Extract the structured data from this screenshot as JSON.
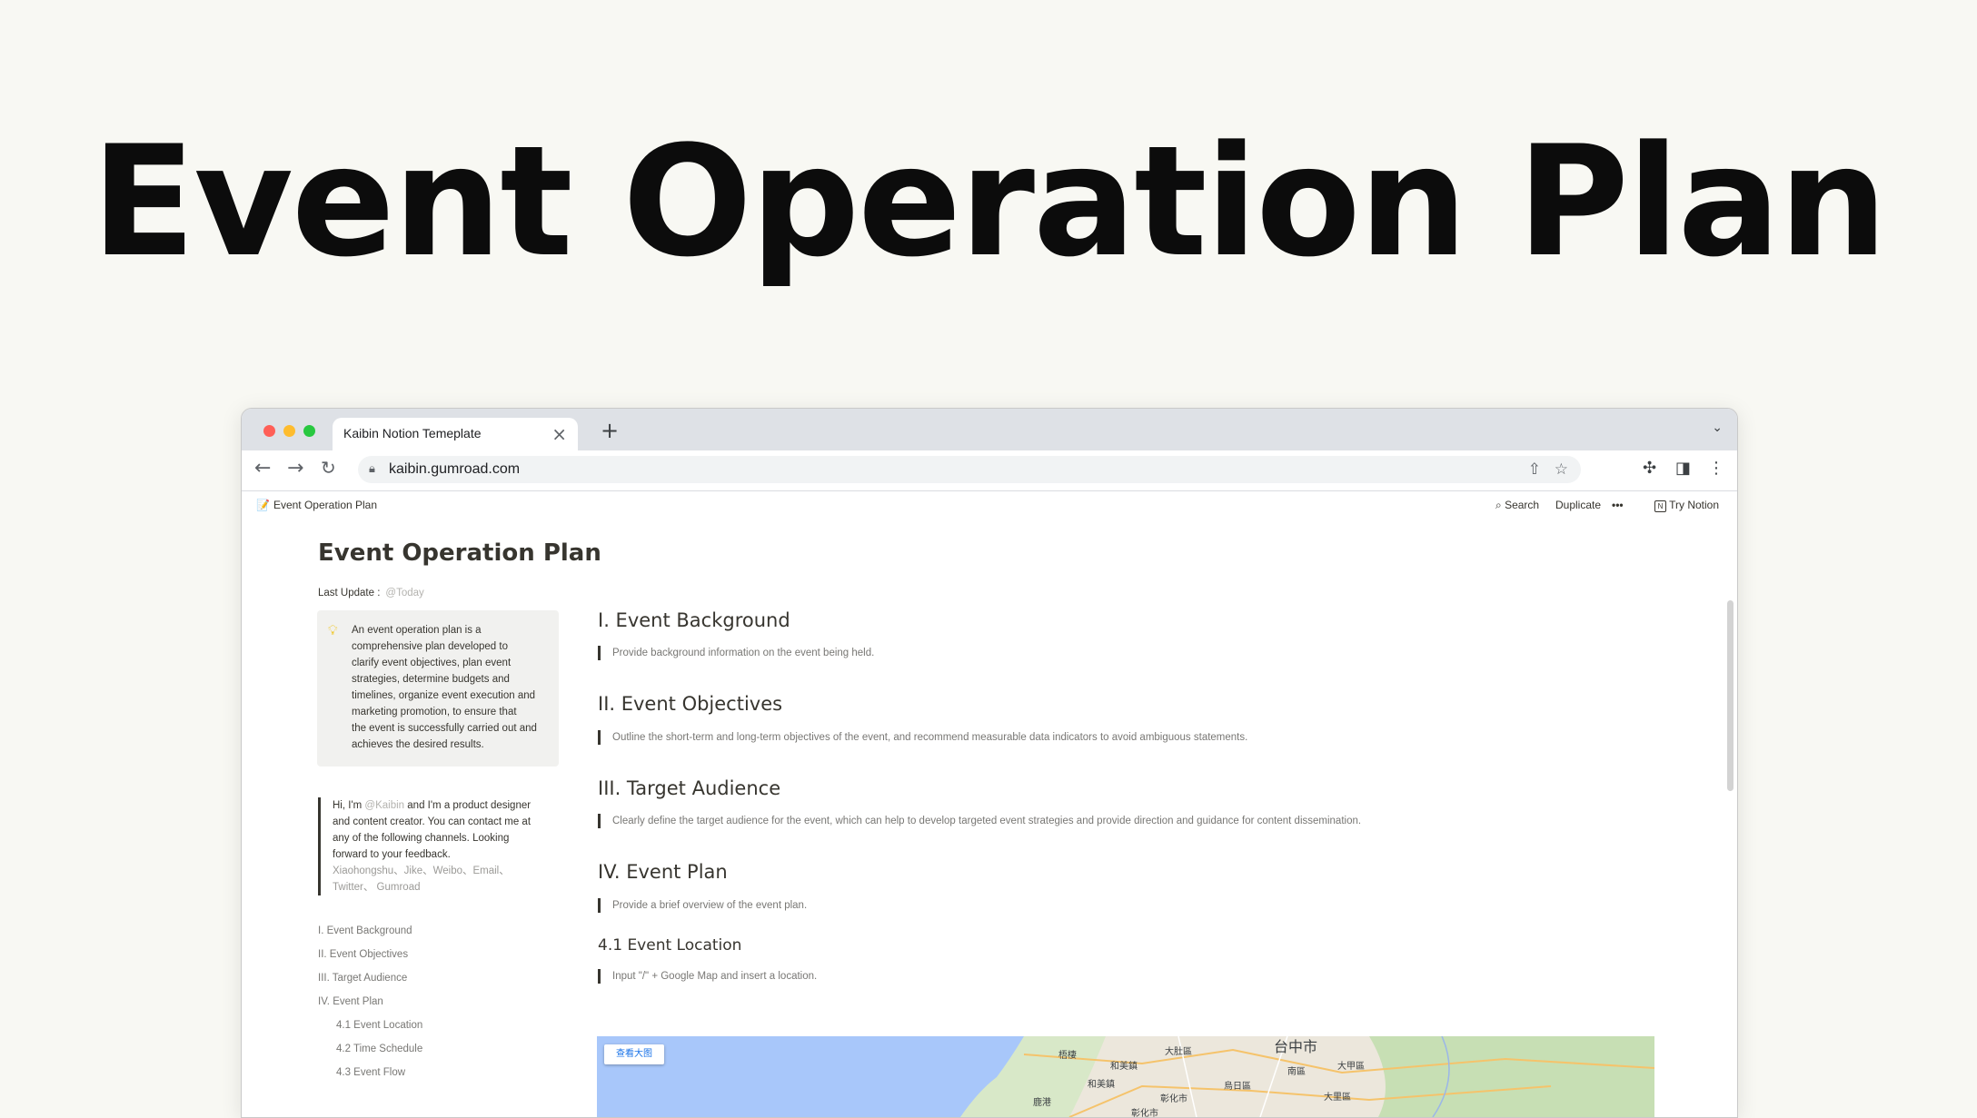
{
  "hero_title": "Event Operation Plan",
  "browser": {
    "tab_title": "Kaibin Notion Temeplate",
    "url": "kaibin.gumroad.com"
  },
  "notion": {
    "breadcrumb": "Event Operation Plan",
    "search_label": "Search",
    "duplicate_label": "Duplicate",
    "more_label": "•••",
    "try_label": "Try Notion",
    "page_title": "Event Operation Plan",
    "last_update_label": "Last Update :",
    "last_update_value": "@Today",
    "callout_lines": [
      "An event operation plan is a",
      "comprehensive plan developed to",
      "clarify event objectives, plan event",
      "strategies, determine budgets and",
      "timelines, organize event execution and",
      "marketing promotion, to ensure that",
      "the event is successfully carried out and",
      "achieves the desired results."
    ],
    "quote": {
      "l1_pre": "Hi, I'm ",
      "mention": "@Kaibin",
      "l1_post": " and I'm a product designer",
      "l2": "and content creator. You can contact me at",
      "l3": "any of the following channels. Looking",
      "l4": "forward to your feedback.",
      "l5": "Xiaohongshu、Jike、Weibo、Email、",
      "l6": "Twitter、 Gumroad"
    },
    "toc": [
      "I. Event Background",
      "II. Event Objectives",
      "III. Target Audience",
      "IV. Event Plan",
      "4.1 Event Location",
      "4.2 Time Schedule",
      "4.3 Event Flow"
    ],
    "sections": [
      {
        "heading": "I. Event Background",
        "desc": "Provide background information on the event being held."
      },
      {
        "heading": "II. Event Objectives",
        "desc": "Outline the short-term and long-term objectives of the event, and recommend measurable data indicators to avoid ambiguous statements."
      },
      {
        "heading": "III. Target Audience",
        "desc": "Clearly define the target audience for the event, which can help to develop targeted event strategies and provide direction and guidance for content dissemination."
      },
      {
        "heading": "IV. Event Plan",
        "desc": "Provide a brief overview of the event plan."
      },
      {
        "heading": "4.1 Event Location",
        "desc": "Input \"/\" + Google Map and insert a location."
      }
    ],
    "map": {
      "view_larger": "查看大图",
      "labels": [
        "梧棲",
        "和美鎮",
        "大肚區",
        "台中市",
        "南區",
        "大甲區",
        "和美鎮",
        "烏日區",
        "大里區",
        "彰化市",
        "鹿港",
        "彰化市"
      ]
    }
  },
  "colors": {
    "background": "#f8f8f3",
    "hero_text": "#0c0c0c",
    "notion_text": "#37352f",
    "map_water": "#a8c7fa",
    "map_land": "#d8e8c8"
  }
}
